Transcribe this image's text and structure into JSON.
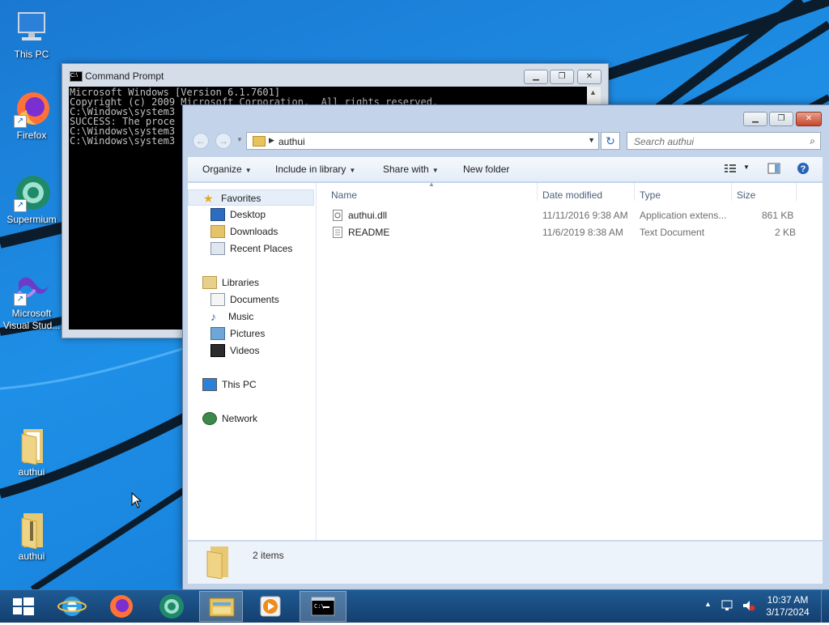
{
  "desktop": {
    "icons": [
      {
        "label": "This PC",
        "icon": "computer-icon"
      },
      {
        "label": "Firefox",
        "icon": "firefox-icon"
      },
      {
        "label": "Supermium",
        "icon": "supermium-icon"
      },
      {
        "label": "Microsoft Visual Stud...",
        "icon": "visual-studio-icon"
      },
      {
        "label": "authui",
        "icon": "folder-icon"
      },
      {
        "label": "authui",
        "icon": "zip-folder-icon"
      }
    ]
  },
  "cmd": {
    "title": "Command Prompt",
    "lines": [
      "Microsoft Windows [Version 6.1.7601]",
      "Copyright (c) 2009 Microsoft Corporation.  All rights reserved.",
      "",
      "C:\\Windows\\system3",
      "SUCCESS: The proce",
      "",
      "C:\\Windows\\system3",
      "",
      "C:\\Windows\\system3"
    ]
  },
  "explorer": {
    "breadcrumb": "authui",
    "search_placeholder": "Search authui",
    "toolbar": {
      "organize": "Organize",
      "include": "Include in library",
      "share": "Share with",
      "new_folder": "New folder"
    },
    "nav": {
      "favorites": "Favorites",
      "desktop": "Desktop",
      "downloads": "Downloads",
      "recent": "Recent Places",
      "libraries": "Libraries",
      "documents": "Documents",
      "music": "Music",
      "pictures": "Pictures",
      "videos": "Videos",
      "thispc": "This PC",
      "network": "Network"
    },
    "columns": {
      "name": "Name",
      "date": "Date modified",
      "type": "Type",
      "size": "Size"
    },
    "files": [
      {
        "name": "authui.dll",
        "date": "11/11/2016 9:38 AM",
        "type": "Application extens...",
        "size": "861 KB",
        "icon": "dll-file-icon"
      },
      {
        "name": "README",
        "date": "11/6/2019 8:38 AM",
        "type": "Text Document",
        "size": "2 KB",
        "icon": "text-file-icon"
      }
    ],
    "status": "2 items"
  },
  "taskbar": {
    "pinned": [
      "start-icon",
      "internet-explorer-icon",
      "firefox-icon",
      "supermium-icon",
      "file-explorer-icon",
      "media-player-icon",
      "cmd-icon"
    ],
    "clock": {
      "time": "10:37 AM",
      "date": "3/17/2024"
    }
  },
  "colors": {
    "accent": "#1e8fe6",
    "taskbar": "#174a7e",
    "selection": "#e5eef9"
  }
}
